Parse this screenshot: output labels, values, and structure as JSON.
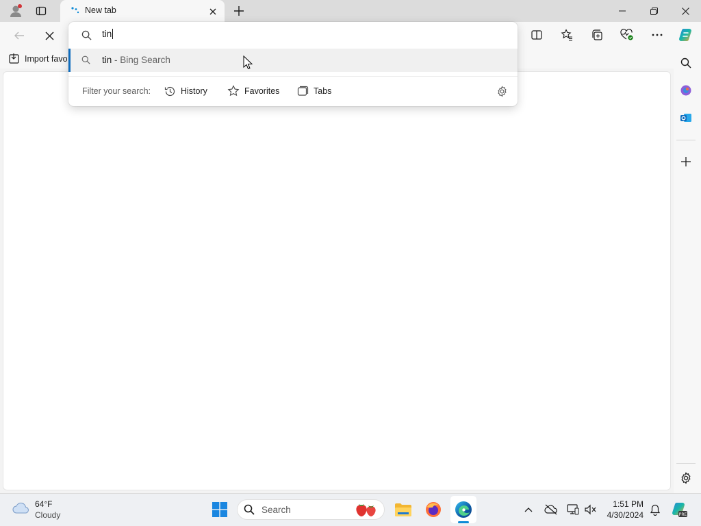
{
  "tab": {
    "title": "New tab"
  },
  "omnibox": {
    "value": "tin"
  },
  "suggestion": {
    "query": "tin",
    "separator": "-",
    "source": "Bing Search"
  },
  "filter": {
    "label": "Filter your search:",
    "options": [
      {
        "label": "History",
        "icon": "history-icon"
      },
      {
        "label": "Favorites",
        "icon": "star-icon"
      },
      {
        "label": "Tabs",
        "icon": "tabs-icon"
      }
    ]
  },
  "favorites_bar": {
    "import_label": "Import favo"
  },
  "taskbar": {
    "weather": {
      "temp": "64°F",
      "desc": "Cloudy"
    },
    "search_label": "Search",
    "time": "1:51 PM",
    "date": "4/30/2024"
  },
  "colors": {
    "accent": "#0f6cbd",
    "edge": "#0c8ad6"
  }
}
